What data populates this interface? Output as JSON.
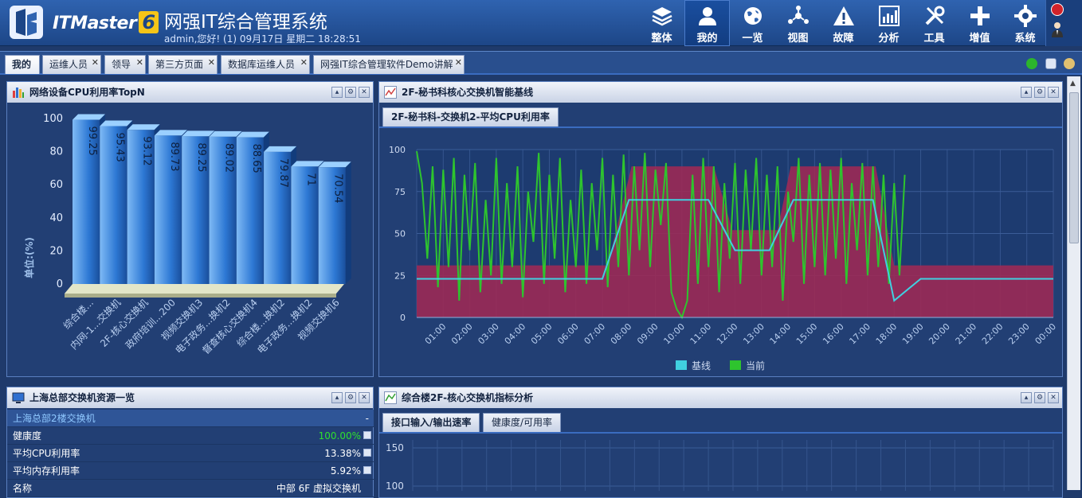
{
  "header": {
    "brand": "ITMaster",
    "brand_version": "6",
    "system_title": "网强IT综合管理系统",
    "user_line": "admin,您好! (1) 09月17日 星期二 18:28:51"
  },
  "nav": [
    {
      "label": "整体",
      "icon": "layers-icon"
    },
    {
      "label": "我的",
      "icon": "user-icon",
      "active": true
    },
    {
      "label": "一览",
      "icon": "globe-icon"
    },
    {
      "label": "视图",
      "icon": "network-icon"
    },
    {
      "label": "故障",
      "icon": "warning-icon"
    },
    {
      "label": "分析",
      "icon": "chart-icon"
    },
    {
      "label": "工具",
      "icon": "tools-icon"
    },
    {
      "label": "增值",
      "icon": "plus-icon"
    },
    {
      "label": "系统",
      "icon": "gear-icon"
    }
  ],
  "tabs": [
    {
      "label": "我的",
      "active": true
    },
    {
      "label": "运维人员"
    },
    {
      "label": "领导"
    },
    {
      "label": "第三方页面"
    },
    {
      "label": "数据库运维人员"
    },
    {
      "label": "网强IT综合管理软件Demo讲解"
    }
  ],
  "panels": {
    "cpu_top": {
      "title": "网络设备CPU利用率TopN"
    },
    "baseline": {
      "title": "2F-秘书科核心交换机智能基线",
      "subtab": "2F-秘书科-交换机2-平均CPU利用率"
    },
    "resources": {
      "title": "上海总部交换机资源一览",
      "device": "上海总部2楼交换机",
      "device_value": "-",
      "rows": [
        {
          "label": "健康度",
          "value": "100.00%",
          "good": true
        },
        {
          "label": "平均CPU利用率",
          "value": "13.38%"
        },
        {
          "label": "平均内存利用率",
          "value": "5.92%"
        },
        {
          "label": "名称",
          "value": "中部 6F 虚拟交换机"
        }
      ]
    },
    "analysis": {
      "title": "综合楼2F-核心交换机指标分析",
      "subtab_active": "接口输入/输出速率",
      "subtab_other": "健康度/可用率"
    }
  },
  "chart_data": [
    {
      "type": "bar",
      "ylabel": "单位:(%)",
      "ylim": [
        0,
        100
      ],
      "yticks": [
        0,
        20,
        40,
        60,
        80,
        100
      ],
      "categories": [
        "综合楼...",
        "内网-1...交换机",
        "2F-核心交换机",
        "政府培训...200",
        "视频交换机3",
        "电子政务...换机2",
        "督查核心交换机4",
        "综合楼...换机2",
        "电子政务...换机2",
        "视频交换机6"
      ],
      "values": [
        99.25,
        95.43,
        93.12,
        89.73,
        89.25,
        89.02,
        88.65,
        79.87,
        71,
        70.54
      ],
      "color": "#3a86e0"
    },
    {
      "type": "line",
      "ylim": [
        0,
        100
      ],
      "yticks": [
        0,
        25,
        50,
        75,
        100
      ],
      "xticks": [
        "01:00",
        "02:00",
        "03:00",
        "04:00",
        "05:00",
        "06:00",
        "07:00",
        "08:00",
        "09:00",
        "10:00",
        "11:00",
        "12:00",
        "13:00",
        "14:00",
        "15:00",
        "16:00",
        "17:00",
        "18:00",
        "19:00",
        "20:00",
        "21:00",
        "22:00",
        "23:00",
        "00:00"
      ],
      "legend": [
        "基线",
        "当前"
      ],
      "baseline_color": "#40d0e0",
      "current_color": "#2ec42e",
      "band_color": "#9c2a55",
      "baseline": [
        [
          0,
          23
        ],
        [
          7,
          23
        ],
        [
          8,
          70
        ],
        [
          11,
          70
        ],
        [
          12,
          40
        ],
        [
          13.3,
          40
        ],
        [
          14.2,
          70
        ],
        [
          17.2,
          70
        ],
        [
          18,
          10
        ],
        [
          19,
          23
        ],
        [
          24,
          23
        ]
      ],
      "band_upper": [
        [
          0,
          31
        ],
        [
          7.2,
          31
        ],
        [
          8.1,
          90
        ],
        [
          11.2,
          90
        ],
        [
          11.9,
          52
        ],
        [
          13.6,
          52
        ],
        [
          14.1,
          90
        ],
        [
          17.3,
          90
        ],
        [
          18,
          31
        ],
        [
          24,
          31
        ]
      ],
      "band_lower": [
        [
          0,
          0
        ],
        [
          24,
          0
        ]
      ],
      "current": [
        [
          0,
          99
        ],
        [
          0.2,
          80
        ],
        [
          0.4,
          35
        ],
        [
          0.6,
          90
        ],
        [
          0.8,
          18
        ],
        [
          1,
          88
        ],
        [
          1.2,
          30
        ],
        [
          1.4,
          95
        ],
        [
          1.6,
          10
        ],
        [
          1.8,
          85
        ],
        [
          2,
          40
        ],
        [
          2.2,
          92
        ],
        [
          2.4,
          15
        ],
        [
          2.6,
          70
        ],
        [
          2.8,
          25
        ],
        [
          3,
          95
        ],
        [
          3.2,
          20
        ],
        [
          3.4,
          80
        ],
        [
          3.6,
          30
        ],
        [
          3.8,
          90
        ],
        [
          4,
          12
        ],
        [
          4.2,
          75
        ],
        [
          4.4,
          45
        ],
        [
          4.6,
          98
        ],
        [
          4.8,
          20
        ],
        [
          5,
          85
        ],
        [
          5.2,
          35
        ],
        [
          5.4,
          95
        ],
        [
          5.6,
          15
        ],
        [
          5.8,
          70
        ],
        [
          6,
          30
        ],
        [
          6.2,
          88
        ],
        [
          6.4,
          20
        ],
        [
          6.6,
          80
        ],
        [
          6.8,
          40
        ],
        [
          7,
          95
        ],
        [
          7.2,
          18
        ],
        [
          7.4,
          85
        ],
        [
          7.6,
          30
        ],
        [
          7.8,
          97
        ],
        [
          8,
          25
        ],
        [
          8.2,
          90
        ],
        [
          8.4,
          40
        ],
        [
          8.6,
          98
        ],
        [
          8.8,
          30
        ],
        [
          9,
          88
        ],
        [
          9.2,
          55
        ],
        [
          9.4,
          92
        ],
        [
          9.6,
          15
        ],
        [
          9.8,
          5
        ],
        [
          10,
          0
        ],
        [
          10.2,
          10
        ],
        [
          10.4,
          85
        ],
        [
          10.6,
          20
        ],
        [
          10.8,
          95
        ],
        [
          11,
          30
        ],
        [
          11.2,
          90
        ],
        [
          11.4,
          15
        ],
        [
          11.6,
          80
        ],
        [
          11.8,
          35
        ],
        [
          12,
          92
        ],
        [
          12.2,
          20
        ],
        [
          12.4,
          88
        ],
        [
          12.6,
          40
        ],
        [
          12.8,
          95
        ],
        [
          13,
          25
        ],
        [
          13.2,
          85
        ],
        [
          13.4,
          30
        ],
        [
          13.6,
          90
        ],
        [
          13.8,
          10
        ],
        [
          14,
          75
        ],
        [
          14.2,
          45
        ],
        [
          14.4,
          95
        ],
        [
          14.6,
          20
        ],
        [
          14.8,
          85
        ],
        [
          15,
          30
        ],
        [
          15.2,
          92
        ],
        [
          15.4,
          25
        ],
        [
          15.6,
          88
        ],
        [
          15.8,
          35
        ],
        [
          16,
          95
        ],
        [
          16.2,
          20
        ],
        [
          16.4,
          80
        ],
        [
          16.6,
          40
        ],
        [
          16.8,
          92
        ],
        [
          17,
          25
        ],
        [
          17.2,
          90
        ],
        [
          17.4,
          30
        ],
        [
          17.6,
          85
        ],
        [
          17.8,
          20
        ],
        [
          18,
          80
        ],
        [
          18.2,
          25
        ],
        [
          18.4,
          85
        ]
      ]
    }
  ]
}
